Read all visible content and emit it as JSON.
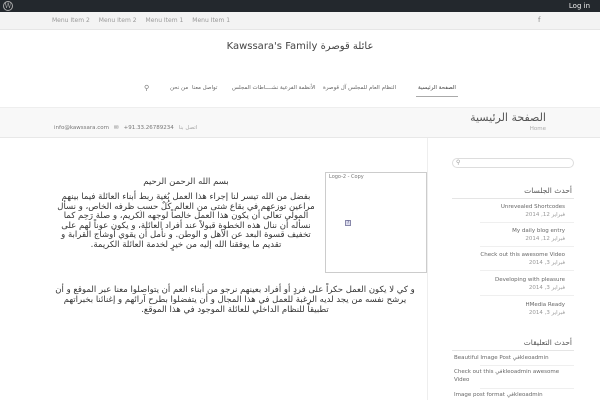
{
  "admin_bar": {
    "wp_icon": "wordpress-icon",
    "wp_glyph": "W",
    "login": "Log in"
  },
  "top_nav": {
    "items": [
      "Menu Item 2",
      "Menu Item 2",
      "Menu Item 1",
      "Menu Item 1"
    ],
    "facebook_icon": "facebook-icon",
    "facebook_glyph": "f"
  },
  "site_title": "Kawssara's Family عائلة قوصرة",
  "main_nav": {
    "search_icon": "search-icon",
    "search_glyph": "⚲",
    "items": [
      "من نحن",
      "تواصل معنا",
      "نشــــاطات المجلس",
      "الأنظمة الفرعية",
      "النظام العام للمجلس آل قوصرة",
      "الصفحة الرئيسية"
    ]
  },
  "title_bar": {
    "title": "الصفحة الرئيسية",
    "breadcrumb": "Home",
    "phone": "+91.33.26789234",
    "phone_label": "اتصل بنا",
    "email": "info@kawssara.com",
    "email_icon": "envelope-icon",
    "email_glyph": "✉"
  },
  "content": {
    "logo_caption": "Logo-2 - Copy",
    "broken_image_glyph": "?",
    "basmala": "بسم الله الرحمن الرحيم",
    "para1": "بفضل من الله تيسر لنا إجراء هذا العمل بُغية ربط أبناء العائلة فيما بينهم مراعين توزعهم في بقاع شتى من العالم كُلٌ حسب ظرفه الخاص، و نسأل المولى تعالى أن يكون هذا العمل خالصاً لوجهه الكريم، و صلة رَحِم كما نسأله أن ننال هذه الخطوة قبولاً عند أفراد العائلة، و يكون عوناً لهم على تخفيف قسوة البعد عن الأهل و الوطن. و نأمل أن يقوي أوشاج القرابة و تقديم ما يوفقنا الله إليه من خيرٍ لخدمة العائلة الكريمة.",
    "para2": "و كي لا يكون العمل حكراً على فردٍ أو أفراد بعينهم نرجو من أبناء العم أن يتواصلوا معنا عبر الموقع و أن يرشح نفسه من يجد لديه الرغبة للعمل في هذا المجال و أن يتفضلوا بطرح آرائهم و إغنائنا بخبراتهم تطبيقاً للنظام الداخلي للعائلة الموجود في هذا الموقع."
  },
  "sidebar": {
    "search_icon": "search-icon",
    "search_glyph": "⚲",
    "recent_title": "أحدث الجلسات",
    "posts": [
      {
        "title": "Unrevealed Shortcodes",
        "date": "فبراير 12, 2014"
      },
      {
        "title": "My daily blog entry",
        "date": "فبراير 12, 2014"
      },
      {
        "title": "Check out this awesome Video",
        "date": "فبراير 3, 2014"
      },
      {
        "title": "Developing with pleasure",
        "date": "فبراير 3, 2014"
      },
      {
        "title": "HMedia Ready",
        "date": "فبراير 3, 2014"
      }
    ],
    "comments_title": "أحدث التعليقات",
    "comments": [
      "Beautiful Image Post فيkleoadmin",
      "Check out this فيkleoadmin awesome Video",
      "Image post format فيkleoadmin"
    ]
  }
}
